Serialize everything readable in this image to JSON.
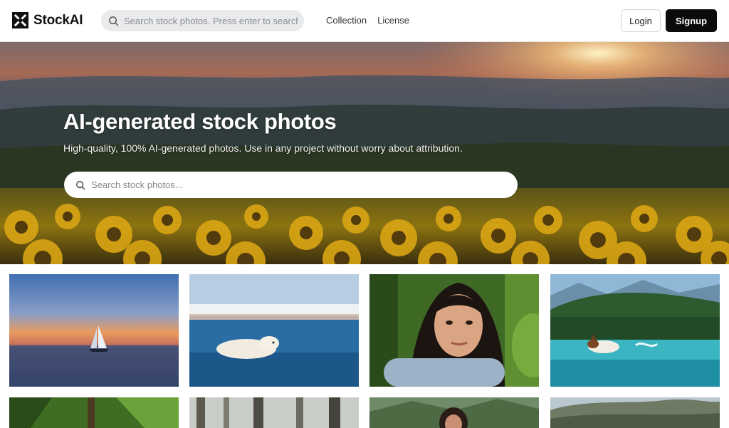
{
  "header": {
    "logo_text": "StockAI",
    "search_placeholder": "Search stock photos. Press enter to search.",
    "nav": [
      {
        "label": "Collection"
      },
      {
        "label": "License"
      }
    ],
    "login_label": "Login",
    "signup_label": "Signup"
  },
  "hero": {
    "title": "AI-generated stock photos",
    "subtitle": "High-quality, 100% AI-generated photos. Use in any project without worry about attribution.",
    "search_placeholder": "Search stock photos..."
  },
  "icons": {
    "logo": "stockai-logo-icon",
    "search": "search-icon"
  },
  "colors": {
    "signup_bg": "#0b0b0b",
    "search_bg": "#e9eaec",
    "hero_text": "#ffffff"
  }
}
